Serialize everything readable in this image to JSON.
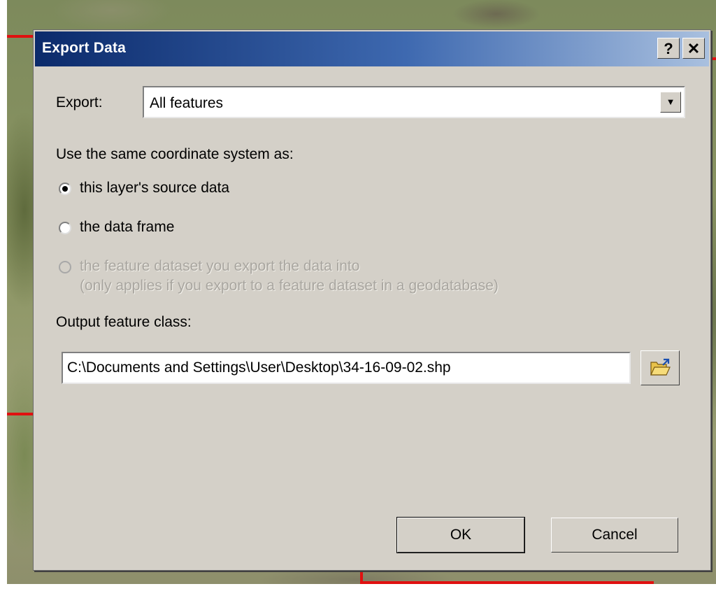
{
  "dialog": {
    "title": "Export Data",
    "help_glyph": "?",
    "close_glyph": "✕"
  },
  "export": {
    "label": "Export:",
    "selected": "All features"
  },
  "coordinate_system": {
    "heading": "Use the same coordinate system as:",
    "options": [
      {
        "label": "this layer's source data",
        "checked": true,
        "enabled": true
      },
      {
        "label": "the data frame",
        "checked": false,
        "enabled": true
      },
      {
        "label": "the feature dataset you export the data into",
        "sublabel": "(only applies if you export to a feature dataset in a geodatabase)",
        "checked": false,
        "enabled": false
      }
    ]
  },
  "output": {
    "label": "Output feature class:",
    "path": "C:\\Documents and Settings\\User\\Desktop\\34-16-09-02.shp",
    "browse_icon": "open-folder-icon"
  },
  "buttons": {
    "ok": "OK",
    "cancel": "Cancel"
  },
  "colors": {
    "titlebar_start": "#0b2a6b",
    "titlebar_end": "#a9c0df",
    "dialog_face": "#d4d0c8",
    "map_boundary": "#e01010"
  }
}
